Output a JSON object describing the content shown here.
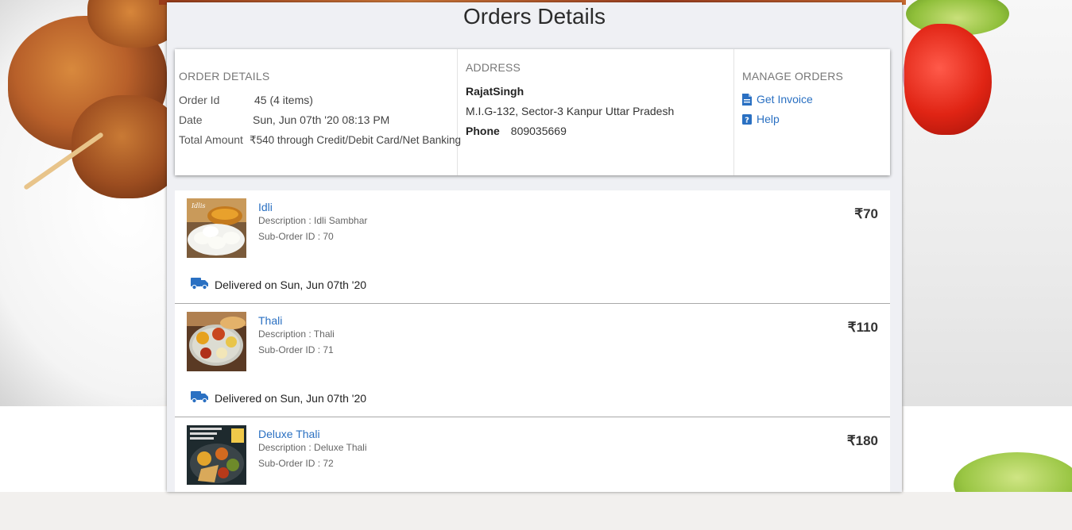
{
  "page": {
    "title": "Orders Details"
  },
  "order_details": {
    "heading": "ORDER DETAILS",
    "rows": [
      {
        "label": "Order Id",
        "value": "45 (4 items)"
      },
      {
        "label": "Date",
        "value": "Sun, Jun 07th '20 08:13 PM"
      },
      {
        "label": "Total Amount",
        "value": "₹540 through Credit/Debit Card/Net Banking"
      }
    ]
  },
  "address": {
    "heading": "ADDRESS",
    "name": "RajatSingh",
    "line": "M.I.G-132, Sector-3 Kanpur Uttar Pradesh",
    "phone_label": "Phone",
    "phone": "809035669"
  },
  "manage_orders": {
    "heading": "MANAGE ORDERS",
    "links": [
      {
        "label": "Get Invoice",
        "icon": "document-icon"
      },
      {
        "label": "Help",
        "icon": "help-icon"
      }
    ]
  },
  "items": [
    {
      "name": "Idli",
      "description": "Description : Idli Sambhar",
      "sub_order": "Sub-Order ID : 70",
      "price": "₹70",
      "delivery": "Delivered on Sun, Jun 07th '20",
      "thumb_label": "Idlis"
    },
    {
      "name": "Thali",
      "description": "Description : Thali",
      "sub_order": "Sub-Order ID : 71",
      "price": "₹110",
      "delivery": "Delivered on Sun, Jun 07th '20"
    },
    {
      "name": "Deluxe Thali",
      "description": "Description : Deluxe Thali",
      "sub_order": "Sub-Order ID : 72",
      "price": "₹180"
    }
  ],
  "colors": {
    "link": "#2a70c2",
    "truck": "#2a70c2",
    "panel_bg": "#eff0f4"
  }
}
